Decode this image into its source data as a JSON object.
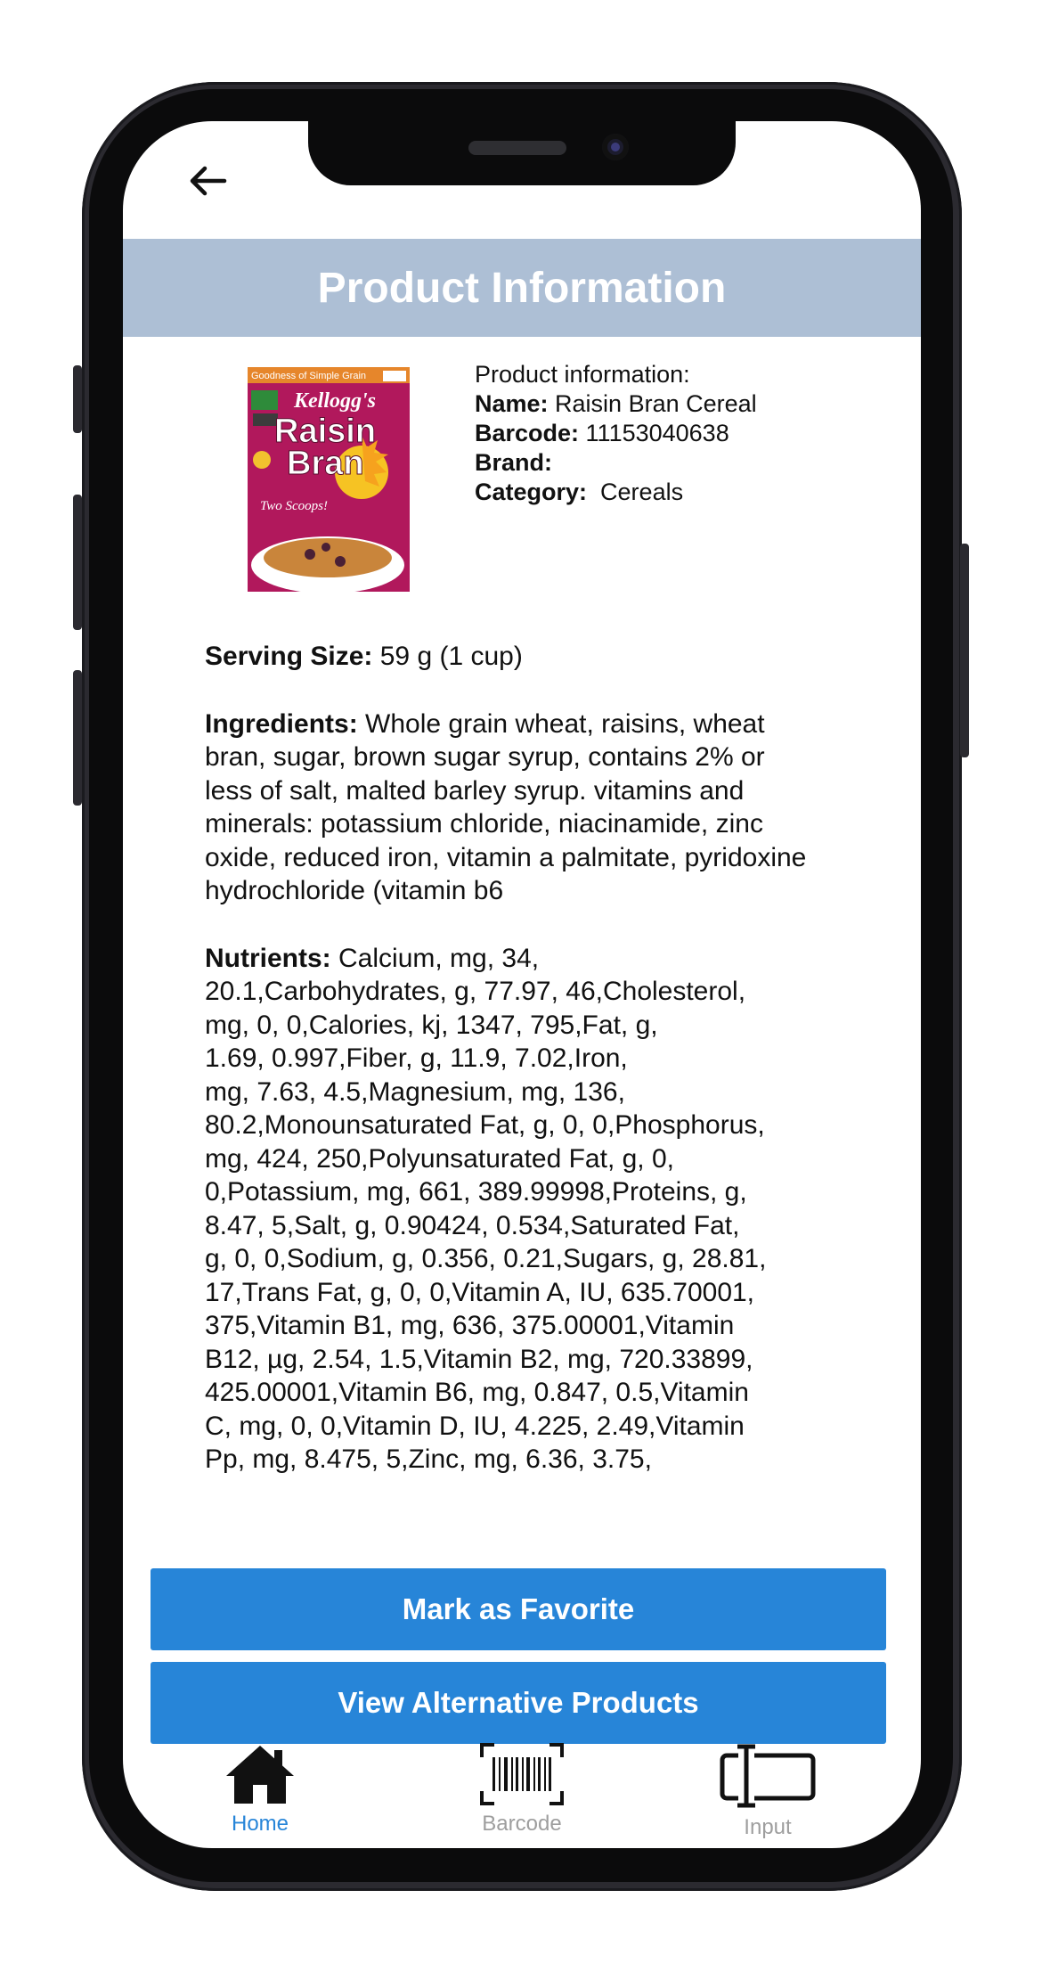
{
  "header": {
    "title": "Product Information"
  },
  "product": {
    "intro": "Product information:",
    "name_label": "Name:",
    "name": "Raisin Bran Cereal",
    "barcode_label": "Barcode:",
    "barcode": "11153040638",
    "brand_label": "Brand:",
    "brand": "",
    "category_label": "Category:",
    "category": "Cereals",
    "box_text": {
      "top": "Goodness of Simple Grain",
      "brand": "Kellogg's",
      "name_line1": "Raisin",
      "name_line2": "Bran",
      "tagline": "Two Scoops!"
    }
  },
  "details": {
    "serving_label": "Serving Size:",
    "serving": "59 g (1 cup)",
    "ingredients_label": "Ingredients:",
    "ingredients": "Whole grain wheat, raisins, wheat bran, sugar, brown sugar syrup, contains 2% or less of salt, malted barley syrup. vitamins and minerals: potassium chloride, niacinamide, zinc oxide, reduced iron, vitamin a palmitate, pyridoxine hydrochloride (vitamin b6",
    "nutrients_label": "Nutrients:",
    "nutrients_lines": [
      "Calcium, mg, 34,",
      "20.1,Carbohydrates, g, 77.97, 46,Cholesterol,",
      "mg, 0, 0,Calories, kj, 1347, 795,Fat, g,",
      "1.69, 0.997,Fiber, g, 11.9, 7.02,Iron,",
      "mg, 7.63, 4.5,Magnesium, mg, 136,",
      "80.2,Monounsaturated Fat, g, 0, 0,Phosphorus,",
      "mg, 424, 250,Polyunsaturated Fat, g, 0,",
      "0,Potassium, mg, 661, 389.99998,Proteins, g,",
      "8.47, 5,Salt, g, 0.90424, 0.534,Saturated Fat,",
      "g, 0, 0,Sodium, g, 0.356, 0.21,Sugars, g, 28.81,",
      "17,Trans Fat, g, 0, 0,Vitamin A, IU, 635.70001,",
      "375,Vitamin B1, mg, 636, 375.00001,Vitamin",
      "B12, µg, 2.54, 1.5,Vitamin B2, mg, 720.33899,",
      "425.00001,Vitamin B6, mg, 0.847, 0.5,Vitamin",
      "C, mg, 0, 0,Vitamin D, IU, 4.225, 2.49,Vitamin",
      "Pp, mg, 8.475, 5,Zinc, mg, 6.36, 3.75,"
    ]
  },
  "actions": {
    "favorite": "Mark as Favorite",
    "alternatives": "View Alternative Products"
  },
  "nav": {
    "home": "Home",
    "barcode": "Barcode",
    "input": "Input",
    "active_color": "#2785d8",
    "inactive_color": "#9e9e9e"
  },
  "colors": {
    "title_bar": "#adbfd5",
    "button": "#2785d8"
  }
}
